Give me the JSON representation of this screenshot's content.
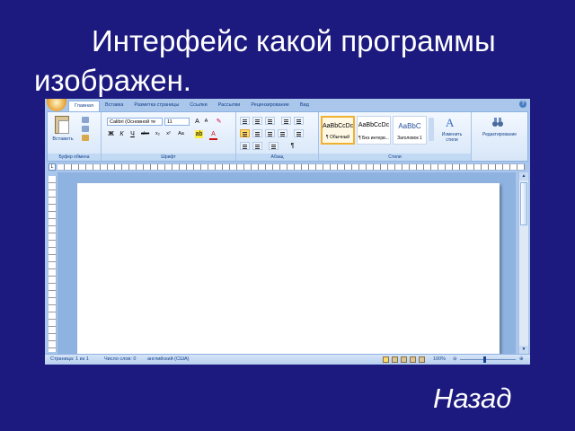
{
  "slide": {
    "title": "Интерфейс какой программы изображен.",
    "back_label": "Назад"
  },
  "ribbon": {
    "tabs": [
      "Главная",
      "Вставка",
      "Разметка страницы",
      "Ссылки",
      "Рассылки",
      "Рецензирование",
      "Вид"
    ],
    "clipboard": {
      "paste_label": "Вставить",
      "group_label": "Буфер обмена"
    },
    "font": {
      "name": "Calibri (Основной те",
      "size": "11",
      "group_label": "Шрифт"
    },
    "paragraph": {
      "group_label": "Абзац"
    },
    "styles": {
      "items": [
        {
          "sample": "AaBbCcDc",
          "name": "¶ Обычный"
        },
        {
          "sample": "AaBbCcDc",
          "name": "¶ Без интерв..."
        },
        {
          "sample": "AaBbC",
          "name": "Заголовок 1"
        }
      ],
      "change_styles_label": "Изменить стили",
      "group_label": "Стили"
    },
    "editing": {
      "label": "Редактирование"
    }
  },
  "statusbar": {
    "page": "Страница: 1 из 1",
    "words": "Число слов: 0",
    "language": "английский (США)",
    "zoom": "100%"
  },
  "colors": {
    "background": "#1c1a7e",
    "ribbon": "#d7e6f8",
    "accent": "#15428b"
  }
}
